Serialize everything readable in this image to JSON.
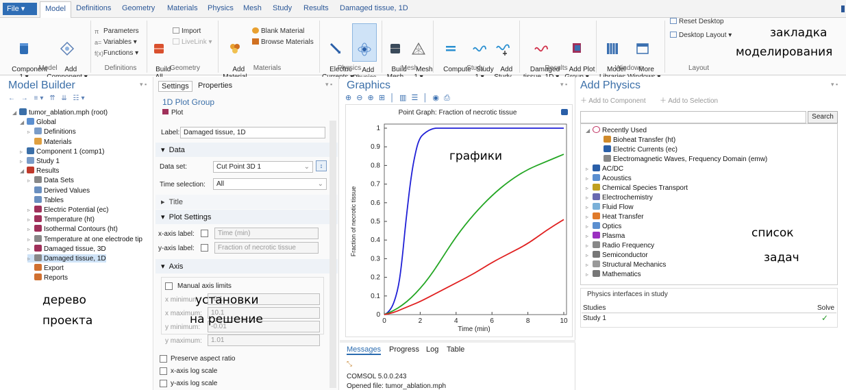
{
  "tabs": [
    "File ▾",
    "Model",
    "Definitions",
    "Geometry",
    "Materials",
    "Physics",
    "Mesh",
    "Study",
    "Results",
    "Damaged tissue, 1D"
  ],
  "ribbon": {
    "component": "Component\n1 ▾",
    "add_component": "Add\nComponent ▾",
    "parameters": "Parameters",
    "variables": "Variables ▾",
    "functions": "Functions ▾",
    "build_all": "Build\nAll",
    "import": "Import",
    "livelink": "LiveLink ▾",
    "add_material": "Add\nMaterial",
    "blank_material": "Blank Material",
    "browse_materials": "Browse Materials",
    "electric_currents": "Electric\nCurrents ▾",
    "add_physics": "Add\nPhysics",
    "build_mesh": "Build\nMesh",
    "mesh1": "Mesh\n1 ▾",
    "compute": "Compute",
    "study1": "Study\n1 ▾",
    "add_study": "Add\nStudy",
    "damaged_tissue": "Damaged\ntissue, 1D ▾",
    "add_plot_group": "Add Plot\nGroup ▾",
    "model_libraries": "Model\nLibraries",
    "more_windows": "More\nWindows ▾",
    "reset_desktop": "Reset Desktop",
    "desktop_layout": "Desktop Layout ▾",
    "groups": [
      "Model",
      "Definitions",
      "Geometry",
      "Materials",
      "Physics",
      "Mesh",
      "Study",
      "Results",
      "Windows",
      "Layout"
    ]
  },
  "annotations": {
    "ribbon_tab": "закладка",
    "ribbon_tab2": "моделирования",
    "graphs": "графики",
    "tasks": "список",
    "tasks2": "задач",
    "tree": "дерево",
    "tree2": "проекта",
    "settings": "установки",
    "settings2": "на решение"
  },
  "model_builder": {
    "title": "Model Builder",
    "tree": [
      {
        "label": "tumor_ablation.mph (root)",
        "level": 0,
        "icon_color": "#3b6fa8"
      },
      {
        "label": "Global",
        "level": 1,
        "icon_color": "#5b8fd0"
      },
      {
        "label": "Definitions",
        "level": 2,
        "icon_color": "#7a9cc8"
      },
      {
        "label": "Materials",
        "level": 2,
        "icon_color": "#e0a040"
      },
      {
        "label": "Component 1 (comp1)",
        "level": 1,
        "icon_color": "#3b6fa8"
      },
      {
        "label": "Study 1",
        "level": 1,
        "icon_color": "#7a9cc8"
      },
      {
        "label": "Results",
        "level": 1,
        "icon_color": "#c0392b"
      },
      {
        "label": "Data Sets",
        "level": 2,
        "icon_color": "#888888"
      },
      {
        "label": "Derived Values",
        "level": 2,
        "icon_color": "#6a8fc0"
      },
      {
        "label": "Tables",
        "level": 2,
        "icon_color": "#6a8fc0"
      },
      {
        "label": "Electric Potential (ec)",
        "level": 2,
        "icon_color": "#a0305a"
      },
      {
        "label": "Temperature (ht)",
        "level": 2,
        "icon_color": "#a0305a"
      },
      {
        "label": "Isothermal Contours (ht)",
        "level": 2,
        "icon_color": "#a0305a"
      },
      {
        "label": "Temperature at one electrode tip",
        "level": 2,
        "icon_color": "#888888"
      },
      {
        "label": "Damaged tissue, 3D",
        "level": 2,
        "icon_color": "#a0305a"
      },
      {
        "label": "Damaged tissue, 1D",
        "level": 2,
        "icon_color": "#888888"
      },
      {
        "label": "Export",
        "level": 2,
        "icon_color": "#d07030"
      },
      {
        "label": "Reports",
        "level": 2,
        "icon_color": "#d07030"
      }
    ]
  },
  "settings": {
    "tab_settings": "Settings",
    "tab_properties": "Properties",
    "group_title": "1D Plot Group",
    "subtitle": "Plot",
    "label_field": "Label:",
    "label_value": "Damaged tissue, 1D",
    "sec_data": "Data",
    "data_set_label": "Data set:",
    "data_set_value": "Cut Point 3D 1",
    "time_sel_label": "Time selection:",
    "time_sel_value": "All",
    "sec_title": "Title",
    "sec_plot_settings": "Plot Settings",
    "x_axis_label": "x-axis label:",
    "x_axis_placeholder": "Time (min)",
    "y_axis_label": "y-axis label:",
    "y_axis_placeholder": "Fraction of necrotic tissue",
    "sec_axis": "Axis",
    "manual_axis": "Manual axis limits",
    "x_min": "x minimum:",
    "x_min_val": "-0.1",
    "x_max": "x maximum:",
    "x_max_val": "10.1",
    "y_min": "y minimum:",
    "y_min_val": "-0.01",
    "y_max": "y maximum:",
    "y_max_val": "1.01",
    "preserve": "Preserve aspect ratio",
    "xlog": "x-axis log scale",
    "ylog": "y-axis log scale"
  },
  "graphics": {
    "title": "Graphics",
    "plot_title": "Point Graph: Fraction of necrotic tissue",
    "tabs": [
      "Messages",
      "Progress",
      "Log",
      "Table"
    ],
    "msg1": "COMSOL 5.0.0.243",
    "msg2": "Opened file: tumor_ablation.mph"
  },
  "chart_data": {
    "type": "line",
    "title": "Point Graph: Fraction of necrotic tissue",
    "xlabel": "Time (min)",
    "ylabel": "Fraction of necrotic tissue",
    "xlim": [
      0,
      10
    ],
    "ylim": [
      0,
      1
    ],
    "xticks": [
      0,
      2,
      4,
      6,
      8,
      10
    ],
    "yticks": [
      0,
      0.1,
      0.2,
      0.3,
      0.4,
      0.5,
      0.6,
      0.7,
      0.8,
      0.9,
      1
    ],
    "grid": false,
    "series": [
      {
        "color": "#1f1fd6",
        "x": [
          0,
          0.2,
          0.5,
          0.8,
          1.0,
          1.2,
          1.5,
          1.8,
          2.0,
          2.2,
          2.5,
          2.8,
          3.0,
          4,
          5,
          6,
          7,
          8,
          9,
          10
        ],
        "y": [
          0,
          0.01,
          0.05,
          0.15,
          0.3,
          0.5,
          0.75,
          0.9,
          0.95,
          0.97,
          0.99,
          1.0,
          1.0,
          1.0,
          1.0,
          1.0,
          1.0,
          1.0,
          1.0,
          1.0
        ]
      },
      {
        "color": "#23a623",
        "x": [
          0,
          0.5,
          1,
          1.5,
          2,
          2.5,
          3,
          4,
          5,
          6,
          7,
          8,
          9,
          10
        ],
        "y": [
          0,
          0.02,
          0.05,
          0.09,
          0.14,
          0.2,
          0.27,
          0.42,
          0.54,
          0.64,
          0.72,
          0.78,
          0.82,
          0.86
        ]
      },
      {
        "color": "#e01f1f",
        "x": [
          0,
          0.5,
          1,
          1.5,
          2,
          3,
          4,
          5,
          6,
          7,
          8,
          9,
          10
        ],
        "y": [
          0,
          0.01,
          0.03,
          0.05,
          0.07,
          0.12,
          0.17,
          0.22,
          0.28,
          0.33,
          0.38,
          0.45,
          0.51
        ]
      }
    ]
  },
  "add_physics": {
    "title": "Add Physics",
    "add_to_component": "Add to Component",
    "add_to_selection": "Add to Selection",
    "search_btn": "Search",
    "recent": "Recently Used",
    "items": [
      {
        "label": "Bioheat Transfer (ht)",
        "level": 2,
        "icon_color": "#d08a2a"
      },
      {
        "label": "Electric Currents (ec)",
        "level": 2,
        "icon_color": "#2a5fa8"
      },
      {
        "label": "Electromagnetic Waves, Frequency Domain (emw)",
        "level": 2,
        "icon_color": "#888888"
      },
      {
        "label": "AC/DC",
        "level": 1,
        "icon_color": "#2a5fa8"
      },
      {
        "label": "Acoustics",
        "level": 1,
        "icon_color": "#5b8fd0"
      },
      {
        "label": "Chemical Species Transport",
        "level": 1,
        "icon_color": "#c0a020"
      },
      {
        "label": "Electrochemistry",
        "level": 1,
        "icon_color": "#6a6ab0"
      },
      {
        "label": "Fluid Flow",
        "level": 1,
        "icon_color": "#7ab0d8"
      },
      {
        "label": "Heat Transfer",
        "level": 1,
        "icon_color": "#e07a2a"
      },
      {
        "label": "Optics",
        "level": 1,
        "icon_color": "#5b8fd0"
      },
      {
        "label": "Plasma",
        "level": 1,
        "icon_color": "#9b30c0"
      },
      {
        "label": "Radio Frequency",
        "level": 1,
        "icon_color": "#888888"
      },
      {
        "label": "Semiconductor",
        "level": 1,
        "icon_color": "#777777"
      },
      {
        "label": "Structural Mechanics",
        "level": 1,
        "icon_color": "#999999"
      },
      {
        "label": "Mathematics",
        "level": 1,
        "icon_color": "#777777"
      }
    ],
    "interfaces_title": "Physics interfaces in study",
    "col_studies": "Studies",
    "col_solve": "Solve",
    "study_row": "Study 1",
    "check": "✓"
  }
}
